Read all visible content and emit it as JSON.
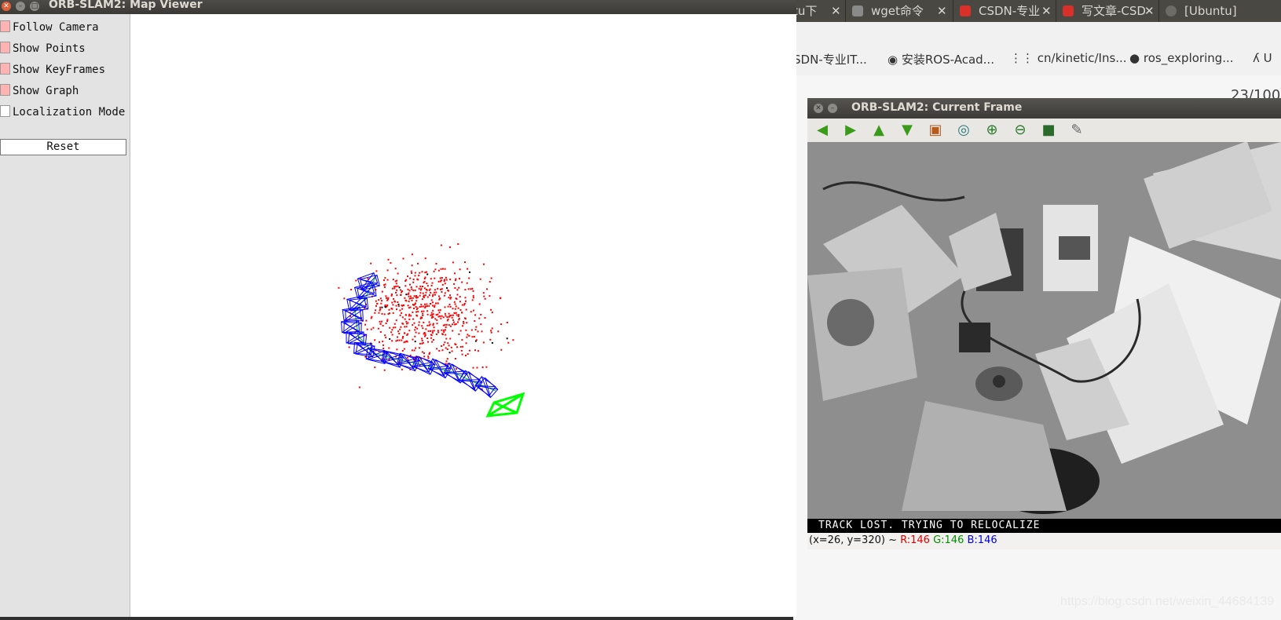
{
  "map_viewer": {
    "title": "ORB-SLAM2: Map Viewer",
    "options": [
      {
        "label": "Follow Camera",
        "checked": true
      },
      {
        "label": "Show Points",
        "checked": true
      },
      {
        "label": "Show KeyFrames",
        "checked": true
      },
      {
        "label": "Show Graph",
        "checked": true
      },
      {
        "label": "Localization Mode",
        "checked": false
      }
    ],
    "reset_label": "Reset",
    "colors": {
      "map_points": "#ff0000",
      "keyframes": "#0000ff",
      "graph": "#00cc00",
      "current_camera": "#00ff00"
    }
  },
  "browser": {
    "tabs": [
      {
        "label": "tu下",
        "favicon_color": "#6d6b66"
      },
      {
        "label": "wget命令",
        "favicon_color": "#8a8a8a"
      },
      {
        "label": "CSDN-专业",
        "favicon_color": "#d9302a"
      },
      {
        "label": "写文章-CSD",
        "favicon_color": "#d9302a"
      },
      {
        "label": "[Ubuntu]",
        "favicon_color": "#6d6b66"
      }
    ],
    "bookmarks": [
      {
        "label": "SDN-专业IT...",
        "icon": "none"
      },
      {
        "label": "安装ROS-Acad...",
        "icon": "globe-icon"
      },
      {
        "label": "cn/kinetic/Ins...",
        "icon": "grid-icon"
      },
      {
        "label": "ros_exploring...",
        "icon": "github-icon"
      },
      {
        "label": "U",
        "icon": "tool-icon"
      }
    ],
    "page_counter": "23/100",
    "watermark": "https://blog.csdn.net/weixin_44684139"
  },
  "current_frame": {
    "title": "ORB-SLAM2: Current Frame",
    "toolbar": [
      "arrow-left-icon",
      "arrow-right-icon",
      "arrow-up-icon",
      "arrow-down-icon",
      "image-icon",
      "zoom-fit-icon",
      "zoom-in-icon",
      "zoom-out-icon",
      "save-icon",
      "properties-icon"
    ],
    "status_text": "TRACK LOST. TRYING TO RELOCALIZE",
    "coords": "(x=26, y=320) ~",
    "r": "R:146",
    "g": "G:146",
    "b": "B:146"
  }
}
